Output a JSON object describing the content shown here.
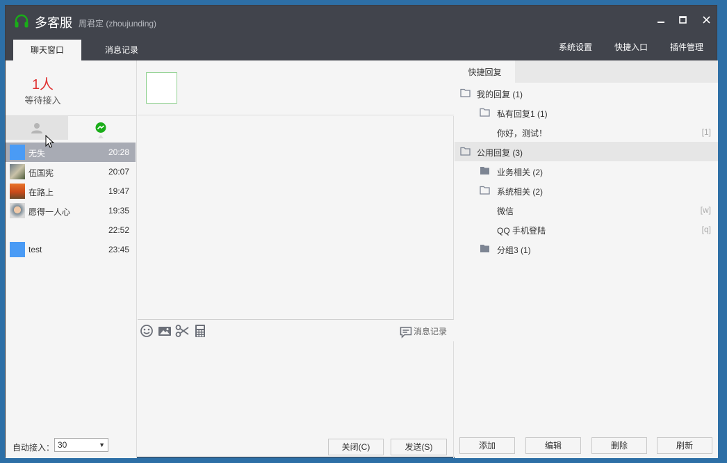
{
  "app": {
    "title": "多客服",
    "user": "周君定 (zhoujunding)"
  },
  "window_controls": {
    "minimize": "▁",
    "maximize": "□",
    "close": "✕"
  },
  "tabs": [
    {
      "label": "聊天窗口"
    },
    {
      "label": "消息记录"
    }
  ],
  "top_links": [
    {
      "label": "系统设置"
    },
    {
      "label": "快捷入口"
    },
    {
      "label": "插件管理"
    }
  ],
  "waiting": {
    "count": "1人",
    "label": "等待接入"
  },
  "sessions": [
    {
      "name": "无失",
      "time": "20:28",
      "avatar": "blue"
    },
    {
      "name": "伍国宪",
      "time": "20:07",
      "avatar": "photo"
    },
    {
      "name": "在路上",
      "time": "19:47",
      "avatar": "sunset"
    },
    {
      "name": "愿得一人心",
      "time": "19:35",
      "avatar": "person"
    },
    {
      "name": "",
      "time": "22:52",
      "avatar": "none"
    },
    {
      "name": "test",
      "time": "23:45",
      "avatar": "blue"
    }
  ],
  "auto_accept": {
    "label": "自动接入：",
    "value": "30"
  },
  "toolbar": {
    "history_label": "消息记录"
  },
  "buttons": {
    "close": "关闭(C)",
    "send": "发送(S)"
  },
  "quick_reply": {
    "tab": "快捷回复",
    "tree": [
      {
        "label": "我的回复 (1)",
        "level": 0,
        "icon": "folder-open",
        "key": ""
      },
      {
        "label": "私有回复1 (1)",
        "level": 1,
        "icon": "folder-open",
        "key": ""
      },
      {
        "label": "你好，测试！",
        "level": 2,
        "icon": "none",
        "key": "[1]"
      },
      {
        "label": "公用回复 (3)",
        "level": 0,
        "icon": "folder-open",
        "key": "",
        "highlight": true
      },
      {
        "label": "业务相关 (2)",
        "level": 1,
        "icon": "folder-closed",
        "key": ""
      },
      {
        "label": "系统相关 (2)",
        "level": 1,
        "icon": "folder-open",
        "key": ""
      },
      {
        "label": "微信",
        "level": 2,
        "icon": "none",
        "key": "[w]"
      },
      {
        "label": "QQ 手机登陆",
        "level": 2,
        "icon": "none",
        "key": "[q]"
      },
      {
        "label": "分组3 (1)",
        "level": 1,
        "icon": "folder-closed",
        "key": ""
      }
    ],
    "actions": {
      "add": "添加",
      "edit": "编辑",
      "delete": "删除",
      "refresh": "刷新"
    }
  },
  "colors": {
    "titlebar": "#41444c",
    "accent_green": "#1aad19",
    "waiting_red": "#e03131",
    "selected_row": "#a8abb4"
  }
}
